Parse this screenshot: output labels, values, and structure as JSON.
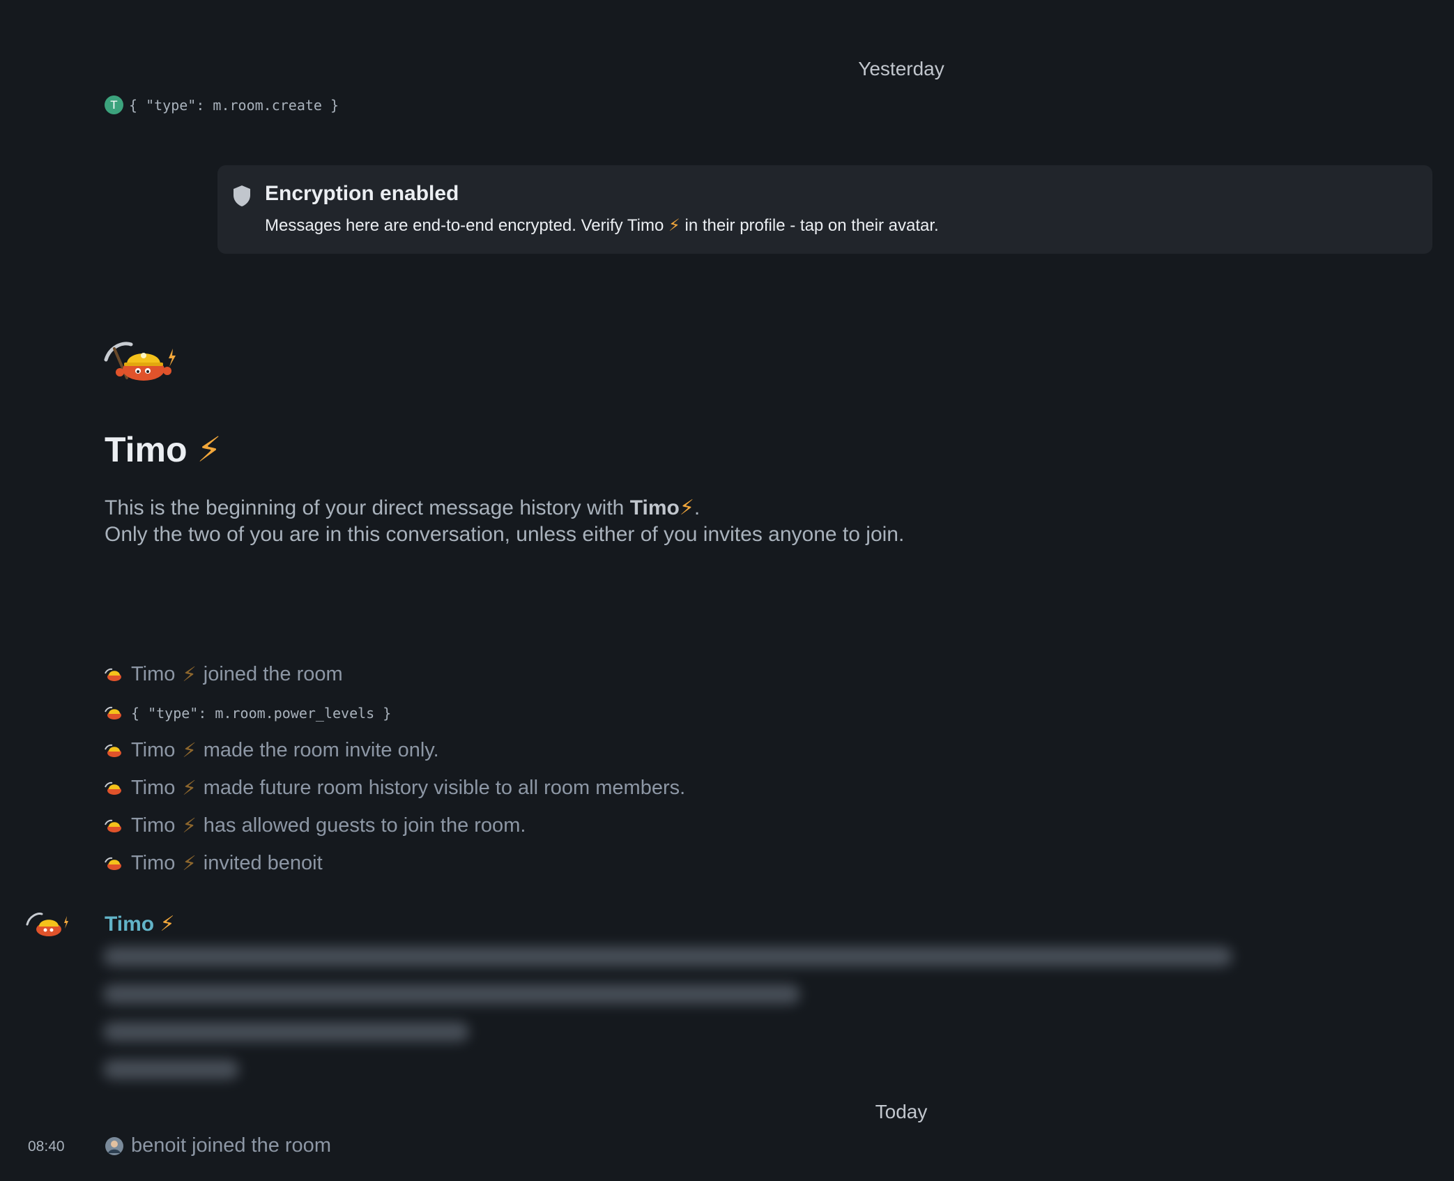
{
  "colors": {
    "background": "#15191e",
    "card": "#21252b",
    "text": "#ebeef2",
    "muted": "#8d97a5",
    "sender": "#62b4c8",
    "bolt": "#f2a73b",
    "avatar_letter": "#3ca37d"
  },
  "timeline": {
    "separator_yesterday": "Yesterday",
    "create_event": {
      "avatar_letter": "T",
      "text": "{ \"type\": m.room.create }"
    },
    "encryption": {
      "icon": "shield-icon",
      "title": "Encryption enabled",
      "body_before": "Messages here are end-to-end encrypted. Verify Timo ",
      "body_bolt": "⚡",
      "body_after": " in their profile - tap on their avatar."
    },
    "room_intro": {
      "avatar_icon": "crab-miner-avatar",
      "title": "Timo",
      "title_bolt": "⚡",
      "desc_line1_before": "This is the beginning of your direct message history with ",
      "desc_line1_name": "Timo",
      "desc_line1_bolt": "⚡",
      "desc_line1_after": ".",
      "desc_line2": "Only the two of you are in this conversation, unless either of you invites anyone to join."
    },
    "events": [
      {
        "name": "Timo",
        "bolt": "⚡",
        "text": "joined the room"
      },
      {
        "mono": "{ \"type\": m.room.power_levels }"
      },
      {
        "name": "Timo",
        "bolt": "⚡",
        "text": "made the room invite only."
      },
      {
        "name": "Timo",
        "bolt": "⚡",
        "text": "made future room history visible to all room members."
      },
      {
        "name": "Timo",
        "bolt": "⚡",
        "text": "has allowed guests to join the room."
      },
      {
        "name": "Timo",
        "bolt": "⚡",
        "text": "invited benoit"
      }
    ],
    "message": {
      "sender": "Timo",
      "sender_bolt": "⚡",
      "content_hidden": true
    },
    "separator_today": "Today",
    "last_event": {
      "time": "08:40",
      "text": "benoit joined the room"
    }
  }
}
